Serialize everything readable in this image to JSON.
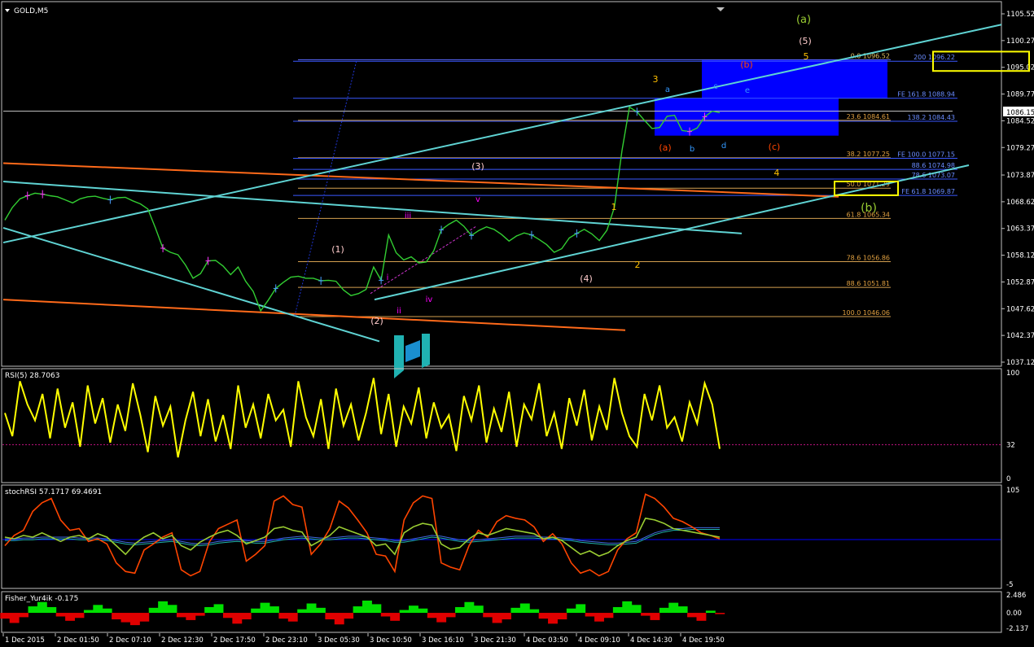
{
  "chart_data": [
    {
      "type": "line",
      "panel": "price",
      "title": "GOLD,M5",
      "ylim": [
        1037.12,
        1105.52
      ],
      "y_ticks": [
        "1105.52",
        "1100.27",
        "1095.02",
        "1089.77",
        "1084.52",
        "1079.27",
        "1073.87",
        "1068.62",
        "1063.37",
        "1058.12",
        "1052.87",
        "1047.62",
        "1042.37",
        "1037.12"
      ],
      "current_price": "1086.15",
      "series": [
        {
          "values": [
            1065,
            1067.5,
            1069.2,
            1069.8,
            1070.3,
            1070.1,
            1069.8,
            1069.6,
            1069,
            1068.4,
            1069.2,
            1069.6,
            1069.7,
            1069.3,
            1069,
            1069.4,
            1069.5,
            1068.8,
            1068.2,
            1067.2,
            1063.5,
            1059.5,
            1058.7,
            1058.2,
            1056.2,
            1053.6,
            1054.5,
            1057,
            1057.1,
            1056,
            1054.3,
            1055.8,
            1053,
            1051,
            1047.2,
            1049.3,
            1051.6,
            1052.8,
            1053.8,
            1054,
            1053.6,
            1053.6,
            1053.1,
            1053.2,
            1053,
            1051.3,
            1050.2,
            1050.6,
            1051.4,
            1055.8,
            1053.2,
            1062.1,
            1058.6,
            1057.2,
            1057.8,
            1056.6,
            1056.8,
            1059,
            1063.1,
            1064.2,
            1065,
            1063.8,
            1062,
            1063,
            1063.7,
            1063.2,
            1062.2,
            1060.9,
            1061.9,
            1062.5,
            1062.1,
            1061.2,
            1060.2,
            1058.7,
            1059.4,
            1061.5,
            1062.4,
            1063.2,
            1062.3,
            1061,
            1063,
            1067.5,
            1078.6,
            1087.2,
            1086.3,
            1084.6,
            1083,
            1083.2,
            1085.4,
            1085.6,
            1082.6,
            1082.4,
            1083.1,
            1085.3,
            1086.4,
            1086.1
          ]
        }
      ],
      "annotations": [
        {
          "text": "(1)",
          "color": "#ffcccc"
        },
        {
          "text": "(2)",
          "color": "#ffcccc"
        },
        {
          "text": "(3)",
          "color": "#ffcccc"
        },
        {
          "text": "(4)",
          "color": "#ffcccc"
        },
        {
          "text": "(5)",
          "color": "#ffcccc"
        },
        {
          "text": "(a)",
          "color": "#9acd32"
        },
        {
          "text": "(b)",
          "color": "#9acd32"
        },
        {
          "text": "i",
          "color": "#ff00ff"
        },
        {
          "text": "ii",
          "color": "#ff00ff"
        },
        {
          "text": "iii",
          "color": "#ff00ff"
        },
        {
          "text": "iv",
          "color": "#ff00ff"
        },
        {
          "text": "v",
          "color": "#ff00ff"
        },
        {
          "text": "1",
          "color": "#ffc000"
        },
        {
          "text": "2",
          "color": "#ffc000"
        },
        {
          "text": "3",
          "color": "#ffc000"
        },
        {
          "text": "4",
          "color": "#ffc000"
        },
        {
          "text": "5",
          "color": "#ffc000"
        },
        {
          "text": "a",
          "color": "#3399ff"
        },
        {
          "text": "b",
          "color": "#3399ff"
        },
        {
          "text": "c",
          "color": "#3399ff"
        },
        {
          "text": "d",
          "color": "#3399ff"
        },
        {
          "text": "e",
          "color": "#3399ff"
        },
        {
          "text": "(a)",
          "color": "#ff4500"
        },
        {
          "text": "(b)",
          "color": "#ff4500"
        },
        {
          "text": "(c)",
          "color": "#ff4500"
        }
      ],
      "fib_levels": [
        {
          "text": "0.0  1096.52",
          "price": 1096.52
        },
        {
          "text": "23.6  1084.61",
          "price": 1084.61
        },
        {
          "text": "38.2  1077.25",
          "price": 1077.25
        },
        {
          "text": "50.0  1071.29",
          "price": 1071.29
        },
        {
          "text": "61.8  1065.34",
          "price": 1065.34
        },
        {
          "text": "78.6  1056.86",
          "price": 1056.86
        },
        {
          "text": "88.6  1051.81",
          "price": 1051.81
        },
        {
          "text": "100.0  1046.06",
          "price": 1046.06
        }
      ],
      "fe_levels": [
        {
          "text": "200  1096.22",
          "price": 1096.22
        },
        {
          "text": "FE 161.8  1088.94",
          "price": 1088.94
        },
        {
          "text": "138.2  1084.43",
          "price": 1084.43
        },
        {
          "text": "FE 100.0  1077.15",
          "price": 1077.15
        },
        {
          "text": "88.6  1074.98",
          "price": 1074.98
        },
        {
          "text": "78.6  1073.07",
          "price": 1073.07
        },
        {
          "text": "FE 61.8  1069.87",
          "price": 1069.87
        }
      ],
      "x_ticks": [
        "1 Dec 2015",
        "2 Dec 01:50",
        "2 Dec 07:10",
        "2 Dec 12:30",
        "2 Dec 17:50",
        "2 Dec 23:10",
        "3 Dec 05:30",
        "3 Dec 10:50",
        "3 Dec 16:10",
        "3 Dec 21:30",
        "4 Dec 03:50",
        "4 Dec 09:10",
        "4 Dec 14:30",
        "4 Dec 19:50"
      ],
      "colors": {
        "price": "#32cd32",
        "channel": "#5fd3d3",
        "trend": "#ff6a1a",
        "fib": "#e0a040",
        "fe": "#3a58ff",
        "box": "#0000ff",
        "highlight": "#ffff00"
      }
    },
    {
      "type": "line",
      "panel": "rsi",
      "title": "RSI(5) 28.7063",
      "ylim": [
        0,
        100
      ],
      "y_ticks": [
        "100",
        "32",
        "0"
      ],
      "series": [
        {
          "values": [
            62,
            40,
            92,
            70,
            55,
            80,
            38,
            85,
            48,
            72,
            30,
            88,
            52,
            76,
            34,
            70,
            45,
            90,
            60,
            25,
            78,
            50,
            68,
            20,
            55,
            82,
            40,
            75,
            35,
            60,
            28,
            88,
            48,
            70,
            38,
            80,
            55,
            65,
            30,
            92,
            58,
            40,
            75,
            28,
            85,
            50,
            70,
            36,
            62,
            95,
            42,
            80,
            30,
            68,
            52,
            86,
            38,
            72,
            48,
            60,
            26,
            78,
            55,
            88,
            34,
            66,
            44,
            82,
            30,
            70,
            56,
            90,
            40,
            62,
            28,
            76,
            50,
            84,
            36,
            68,
            46,
            95,
            62,
            40,
            30,
            80,
            55,
            88,
            48,
            58,
            35,
            72,
            52,
            90,
            70,
            28
          ]
        }
      ],
      "colors": {
        "line": "#ffff00",
        "level": "#c71585"
      }
    },
    {
      "type": "line",
      "panel": "stochrsi",
      "title": "stochRSI 57.1717 69.4691",
      "ylim": [
        -5,
        105
      ],
      "y_ticks": [
        "105",
        "-5"
      ],
      "series": [
        {
          "values": [
            40,
            52,
            58,
            80,
            90,
            95,
            70,
            58,
            60,
            45,
            48,
            42,
            20,
            10,
            8,
            35,
            42,
            50,
            55,
            12,
            5,
            10,
            44,
            60,
            65,
            70,
            22,
            30,
            40,
            92,
            98,
            88,
            85,
            30,
            42,
            60,
            92,
            84,
            70,
            55,
            30,
            28,
            10,
            70,
            90,
            98,
            95,
            20,
            15,
            12,
            40,
            58,
            50,
            68,
            75,
            72,
            70,
            62,
            45,
            54,
            42,
            20,
            8,
            12,
            5,
            10,
            35,
            48,
            55,
            100,
            95,
            85,
            72,
            68,
            62,
            55,
            52,
            48
          ]
        },
        {
          "values": [
            50,
            48,
            52,
            50,
            55,
            50,
            45,
            50,
            52,
            48,
            54,
            50,
            40,
            30,
            42,
            50,
            55,
            48,
            52,
            40,
            35,
            44,
            50,
            55,
            58,
            52,
            42,
            46,
            50,
            60,
            62,
            58,
            56,
            40,
            46,
            52,
            62,
            58,
            54,
            50,
            40,
            42,
            30,
            55,
            62,
            66,
            64,
            42,
            36,
            38,
            48,
            55,
            52,
            56,
            60,
            58,
            56,
            54,
            48,
            50,
            46,
            38,
            30,
            34,
            28,
            32,
            40,
            46,
            50,
            72,
            70,
            66,
            60,
            58,
            56,
            54,
            52,
            50
          ]
        },
        {
          "values": [
            48,
            48,
            49,
            49,
            50,
            50,
            50,
            50,
            49,
            49,
            49,
            48,
            46,
            44,
            43,
            44,
            45,
            46,
            47,
            45,
            43,
            42,
            43,
            45,
            46,
            47,
            46,
            45,
            45,
            47,
            49,
            50,
            51,
            50,
            49,
            49,
            50,
            51,
            51,
            50,
            49,
            48,
            46,
            46,
            48,
            50,
            52,
            51,
            49,
            47,
            46,
            47,
            48,
            49,
            50,
            51,
            51,
            51,
            50,
            50,
            49,
            48,
            46,
            45,
            44,
            43,
            43,
            44,
            45,
            50,
            55,
            58,
            60,
            60,
            61,
            61,
            61,
            61
          ]
        }
      ],
      "colors": {
        "main": "#ff4500",
        "fast": "#9acd32",
        "slow": "#4169e1",
        "slow2": "#20b2aa",
        "level": "#0000ff"
      }
    },
    {
      "type": "bar",
      "panel": "fisher",
      "title": "Fisher_Yur4ik -0.175",
      "ylim": [
        -2.137,
        2.486
      ],
      "y_ticks": [
        "2.486",
        "0.00",
        "-2.137"
      ],
      "series": [
        {
          "values": [
            -0.8,
            -1.4,
            -0.6,
            0.9,
            1.5,
            0.8,
            -0.5,
            -1.1,
            -0.7,
            0.4,
            1.1,
            0.6,
            -0.9,
            -1.3,
            -1.7,
            -1.2,
            0.7,
            1.6,
            1.1,
            -0.6,
            -1.0,
            -0.4,
            0.8,
            1.2,
            -0.7,
            -1.5,
            -0.9,
            0.6,
            1.4,
            0.9,
            -0.8,
            -1.2,
            0.5,
            1.3,
            0.7,
            -0.9,
            -1.6,
            -0.8,
            0.9,
            1.7,
            1.2,
            -0.5,
            -1.1,
            0.4,
            1.0,
            0.6,
            -0.7,
            -1.3,
            -0.6,
            0.8,
            1.5,
            1.0,
            -0.6,
            -1.4,
            -0.9,
            0.7,
            1.3,
            0.5,
            -0.8,
            -1.5,
            -0.9,
            0.6,
            1.2,
            -0.5,
            -1.2,
            -0.7,
            0.8,
            1.6,
            1.1,
            -0.4,
            -1.0,
            0.7,
            1.4,
            0.9,
            -0.6,
            -1.1,
            0.3,
            -0.175
          ]
        }
      ],
      "colors": {
        "positive": "#00e000",
        "negative": "#e00000"
      }
    }
  ]
}
